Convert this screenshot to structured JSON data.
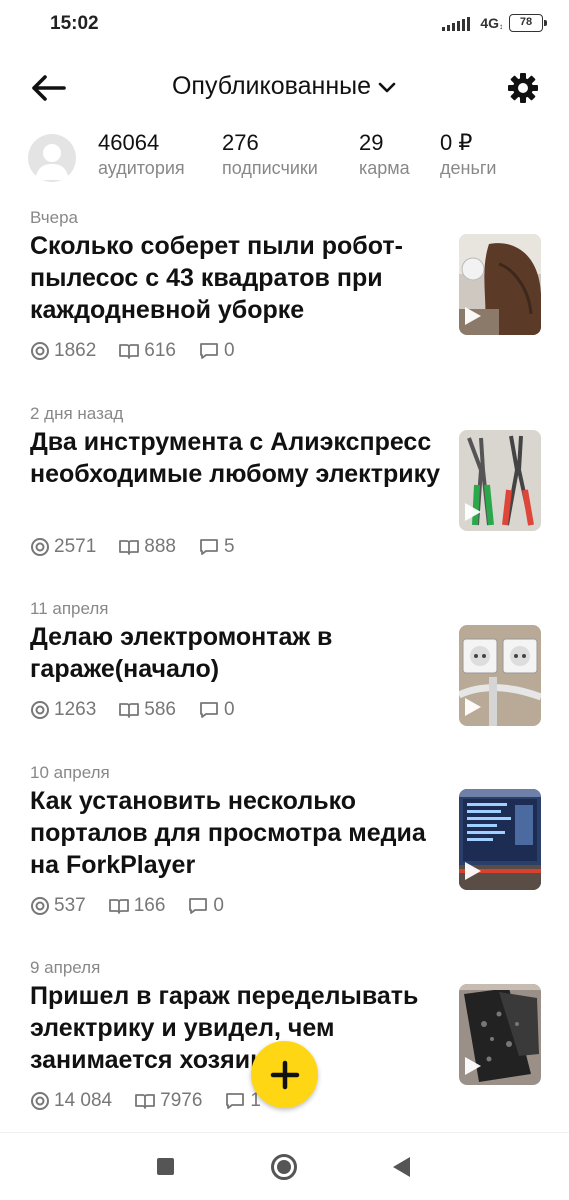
{
  "status_bar": {
    "time": "15:02",
    "network": "4G",
    "battery": "78"
  },
  "header": {
    "title": "Опубликованные"
  },
  "stats": [
    {
      "value": "46064",
      "label": "аудитория"
    },
    {
      "value": "276",
      "label": "подписчики"
    },
    {
      "value": "29",
      "label": "карма"
    },
    {
      "value": "0 ₽",
      "label": "деньги"
    }
  ],
  "articles": [
    {
      "date": "Вчера",
      "title": "Сколько соберет пыли робот-пылесос с 43 квадратов при каждодневной уборке",
      "views": "1862",
      "reads": "616",
      "comments": "0"
    },
    {
      "date": "2 дня назад",
      "title": "Два инструмента с Алиэкспресс необходимые любому электрику",
      "views": "2571",
      "reads": "888",
      "comments": "5"
    },
    {
      "date": "11 апреля",
      "title": "Делаю электромонтаж в гараже(начало)",
      "views": "1263",
      "reads": "586",
      "comments": "0"
    },
    {
      "date": "10 апреля",
      "title": "Как установить несколько порталов для просмотра медиа на ForkPlayer",
      "views": "537",
      "reads": "166",
      "comments": "0"
    },
    {
      "date": "9 апреля",
      "title": "Пришел в гараж переделывать электрику и увидел, чем занимается хозяин",
      "views": "14 084",
      "reads": "7976",
      "comments": "1"
    }
  ],
  "colors": {
    "accent": "#ffd614",
    "muted": "#888888",
    "text": "#111111"
  }
}
